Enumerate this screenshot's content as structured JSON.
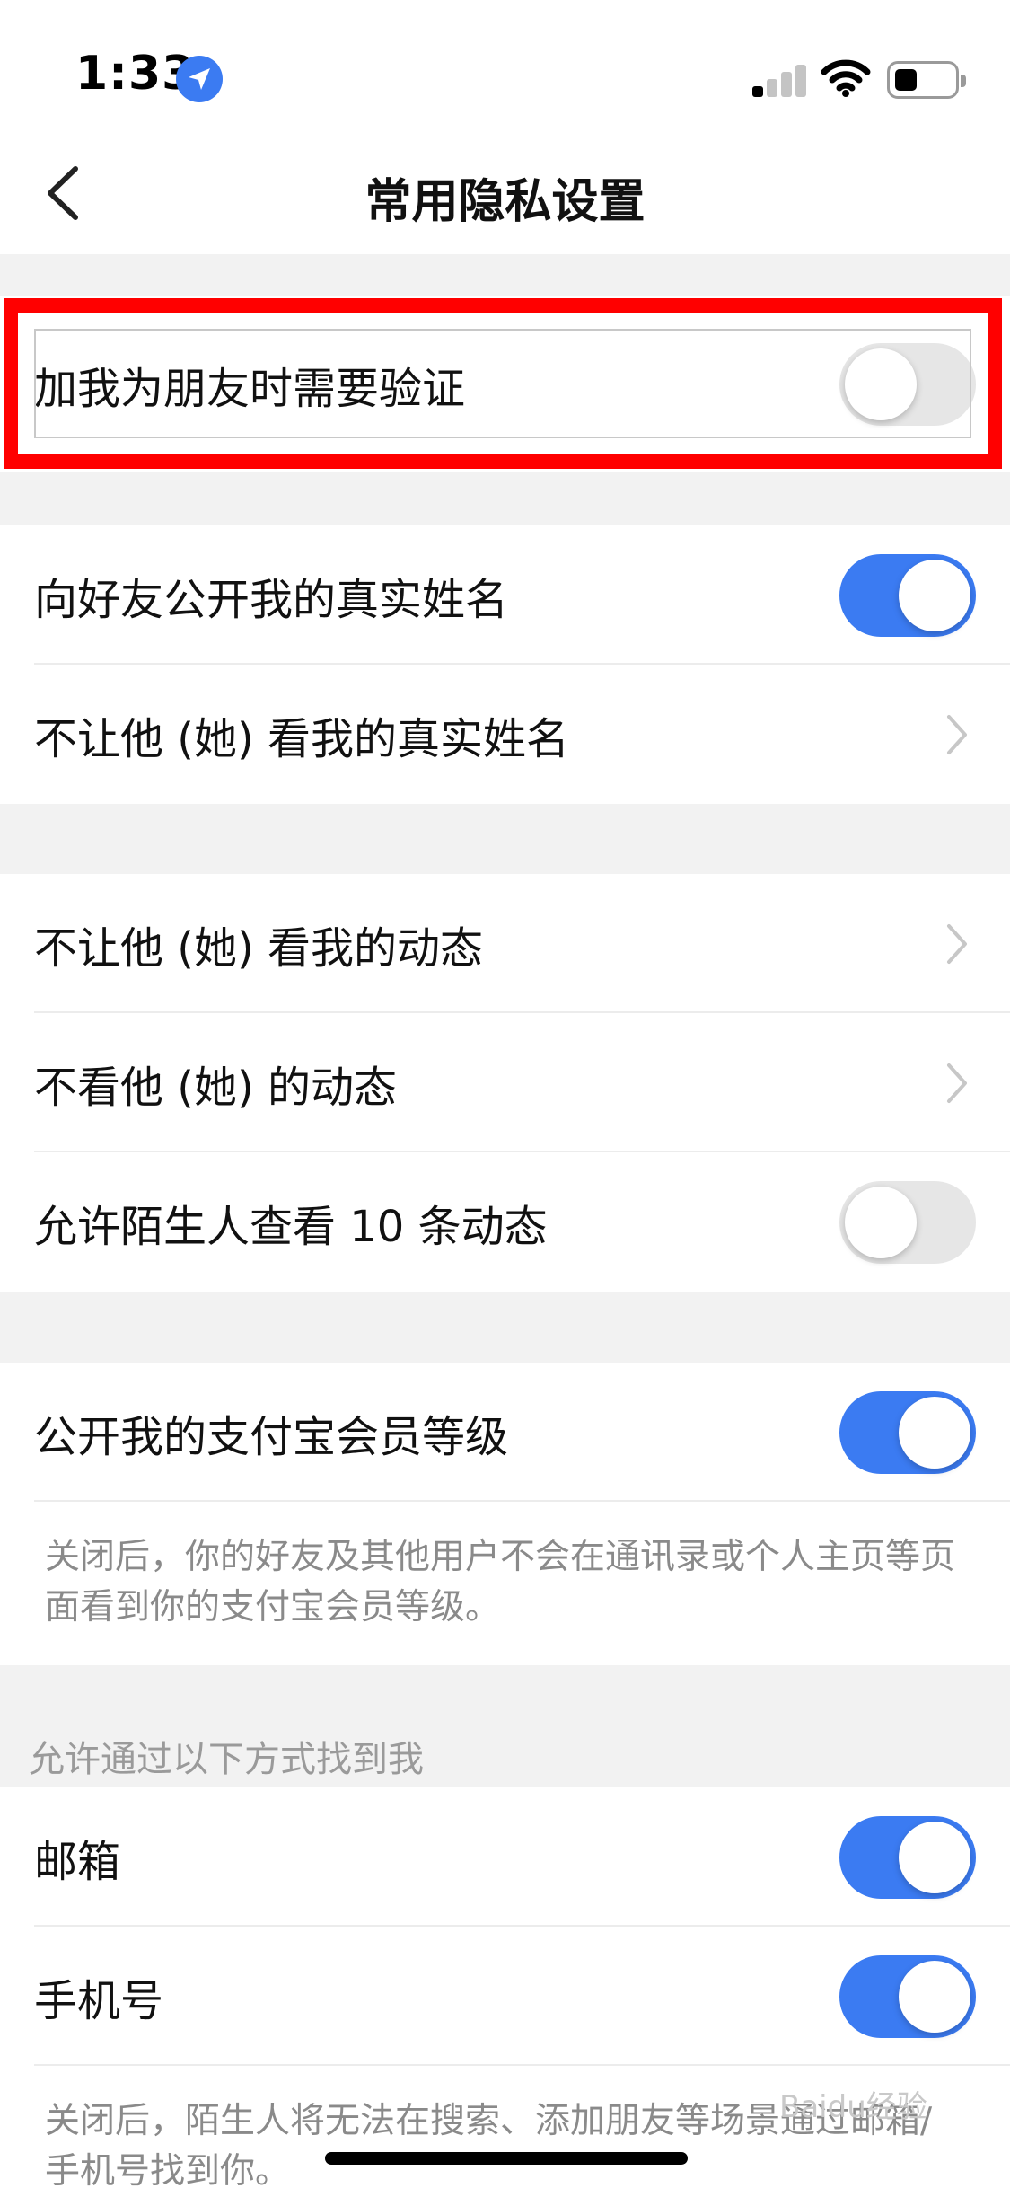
{
  "status_bar": {
    "time": "1:33"
  },
  "nav": {
    "title": "常用隐私设置"
  },
  "rows": {
    "friend_verify": {
      "label": "加我为朋友时需要验证",
      "on": false
    },
    "show_real_name": {
      "label": "向好友公开我的真实姓名",
      "on": true
    },
    "hide_real_name_from": {
      "label": "不让他 (她) 看我的真实姓名"
    },
    "hide_moments_from": {
      "label": "不让他 (她) 看我的动态"
    },
    "dont_see_moments": {
      "label": "不看他 (她) 的动态"
    },
    "stranger_10_posts": {
      "label": "允许陌生人查看 10 条动态",
      "on": false
    },
    "member_level": {
      "label": "公开我的支付宝会员等级",
      "on": true
    }
  },
  "member_level_note": "关闭后，你的好友及其他用户不会在通讯录或个人主页等页面看到你的支付宝会员等级。",
  "find_me": {
    "header": "允许通过以下方式找到我",
    "email": {
      "label": "邮箱",
      "on": true
    },
    "phone": {
      "label": "手机号",
      "on": true
    },
    "note": "关闭后，陌生人将无法在搜索、添加朋友等场景通过邮箱/手机号找到你。"
  },
  "watermark": "Baidu经验",
  "colors": {
    "accent": "#3b7bf2",
    "highlight": "#ff0000",
    "background": "#f2f2f2"
  }
}
